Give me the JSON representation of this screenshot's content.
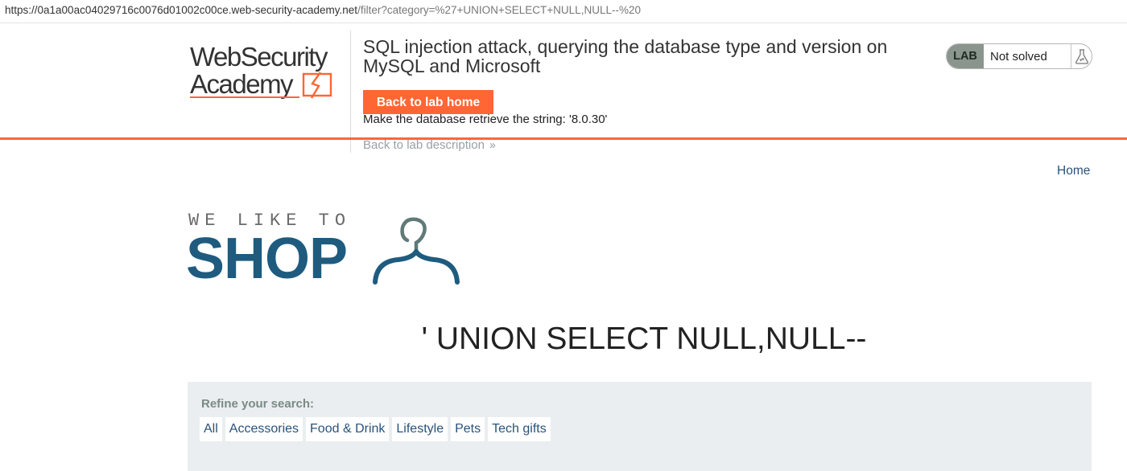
{
  "browser": {
    "url_main": "https://0a1a00ac04029716c0076d01002c00ce.web-security-academy.net",
    "url_rest": "/filter?category=%27+UNION+SELECT+NULL,NULL--%20"
  },
  "lab_header": {
    "logo_text_line1": "WebSecurity",
    "logo_text_line2": "Academy",
    "title": "SQL injection attack, querying the database type and version on MySQL and Microsoft",
    "back_home_label": "Back to lab home",
    "task": "Make the database retrieve the string: '8.0.30'",
    "back_description_label": "Back to lab description",
    "back_description_icon": "double-chevron-right-icon",
    "status": {
      "badge": "LAB",
      "text": "Not solved",
      "icon": "flask-icon"
    },
    "accent_color": "#ff6633"
  },
  "shop": {
    "home_link": "Home",
    "logo_top": "WE LIKE TO",
    "logo_main": "SHOP",
    "logo_icon": "hanger-icon",
    "category_heading": "' UNION SELECT NULL,NULL--",
    "refine_label": "Refine your search:",
    "filters": [
      "All",
      "Accessories",
      "Food & Drink",
      "Lifestyle",
      "Pets",
      "Tech gifts"
    ]
  }
}
